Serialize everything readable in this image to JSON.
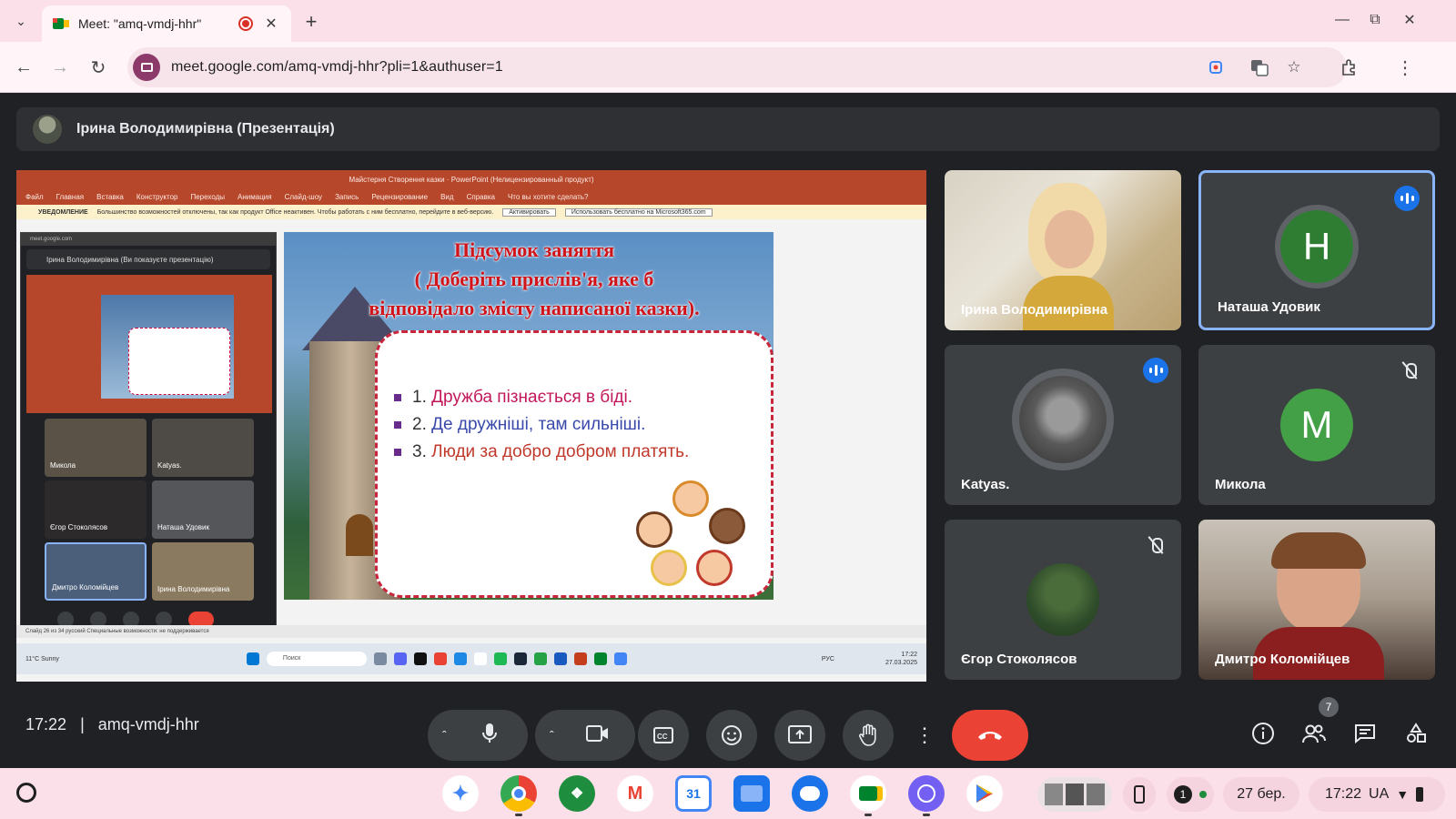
{
  "browser": {
    "tab_title": "Meet: \"amq-vmdj-hhr\"",
    "url": "meet.google.com/amq-vmdj-hhr?pli=1&authuser=1"
  },
  "presenter": {
    "label": "Ірина Володимирівна (Презентація)"
  },
  "ppt": {
    "title": "Майстерня Створення казки · PowerPoint (Нелицензированный продукт)",
    "menu": [
      "Файл",
      "Главная",
      "Вставка",
      "Конструктор",
      "Переходы",
      "Анимация",
      "Слайд-шоу",
      "Запись",
      "Рецензирование",
      "Вид",
      "Справка",
      "Что вы хотите сделать?"
    ],
    "notice_label": "УВЕДОМЛЕНИЕ",
    "notice_text": "Большинство возможностей отключены, так как продукт Office неактивен. Чтобы работать с ним бесплатно, перейдите в веб-версию.",
    "notice_btn_1": "Активировать",
    "notice_btn_2": "Использовать бесплатно на Microsoft365.com",
    "status": "Слайд 26 из 34   русский   Специальные возможности: не поддерживается",
    "taskbar_weather": "11°C Sunny",
    "taskbar_search": "Поиск",
    "taskbar_lang": "РУС",
    "taskbar_time": "17:22",
    "taskbar_date": "27.03.2025"
  },
  "mini_meet": {
    "url": "meet.google.com",
    "bar": "Ірина Володимирівна (Ви показуєте презентацію)",
    "tiles": [
      "Микола",
      "Katyas.",
      "Єгор Стоколясов",
      "Наташа Удовик",
      "Дмитро Коломійцев",
      "Ірина Володимирівна"
    ]
  },
  "slide": {
    "title_1": "Підсумок заняття",
    "title_2": "( Доберіть прислів'я, яке б",
    "title_3": "відповідало змісту написаної казки).",
    "item_1_num": "1.",
    "item_1_text": "Дружба пізнається в біді.",
    "item_2_num": "2.",
    "item_2_text": "Де дружніші, там сильніші.",
    "item_3_num": "3.",
    "item_3_text": "Люди за добро добром платять."
  },
  "participants": [
    {
      "name": "Ірина Володимирівна"
    },
    {
      "name": "Наташа Удовик",
      "initial": "H",
      "color": "#2e7d32"
    },
    {
      "name": "Katyas."
    },
    {
      "name": "Микола",
      "initial": "M",
      "color": "#43a047"
    },
    {
      "name": "Єгор Стоколясов"
    },
    {
      "name": "Дмитро Коломійцев"
    }
  ],
  "meeting": {
    "time": "17:22",
    "separator": "|",
    "code": "amq-vmdj-hhr",
    "people_count": "7"
  },
  "shelf": {
    "date": "27 бер.",
    "time": "17:22",
    "region": "UA",
    "notif_count": "1",
    "calendar_day": "31"
  }
}
